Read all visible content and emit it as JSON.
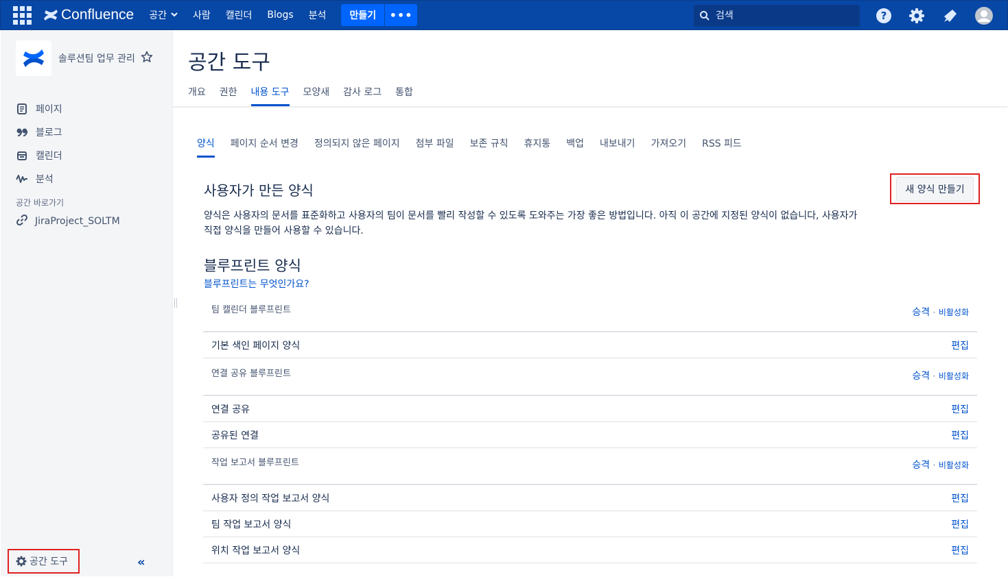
{
  "topnav": {
    "logo_text": "Confluence",
    "items": [
      "공간",
      "사람",
      "캘린더",
      "Blogs",
      "분석"
    ],
    "create_label": "만들기",
    "more_label": "•••",
    "search_placeholder": "검색"
  },
  "sidebar": {
    "space_name": "솔루션팀 업무 관리",
    "nav": [
      {
        "label": "페이지",
        "icon": "page-icon"
      },
      {
        "label": "블로그",
        "icon": "quote-icon"
      },
      {
        "label": "캘린더",
        "icon": "calendar-icon"
      },
      {
        "label": "분석",
        "icon": "analytics-icon"
      }
    ],
    "shortcuts_title": "공간 바로가기",
    "shortcut": "JiraProject_SOLTM",
    "space_tools": "공간 도구",
    "collapse": "«"
  },
  "main": {
    "title": "공간 도구",
    "tabs": [
      "개요",
      "권한",
      "내용 도구",
      "모양새",
      "감사 로그",
      "통합"
    ],
    "active_tab": 2,
    "subtabs": [
      "양식",
      "페이지 순서 변경",
      "정의되지 않은 페이지",
      "첨부 파일",
      "보존 규칙",
      "휴지통",
      "백업",
      "내보내기",
      "가져오기",
      "RSS 피드"
    ],
    "active_subtab": 0,
    "user_templates_title": "사용자가 만든 양식",
    "new_template_button": "새 양식 만들기",
    "description_line1": "양식은 사용자의 문서를 표준화하고 사용자의 팀이 문서를 빨리 작성할 수 있도록 도와주는 가장 좋은 방법입니다. 아직 이 공간에 지정된 양식이 없습니다, 사용자가",
    "description_line2": "직접 양식을 만들어 사용할 수 있습니다.",
    "blueprint_title": "블루프린트 양식",
    "what_link": "블루프린트는 무엇인가요?",
    "promote": "승격",
    "sep": "·",
    "disable": "비활성화",
    "edit": "편집",
    "groups": [
      {
        "name": "팀 캘린더 블루프린트",
        "rows": [
          "기본 색인 페이지 양식"
        ]
      },
      {
        "name": "연결 공유 블루프린트",
        "rows": [
          "연결 공유",
          "공유된 연결"
        ]
      },
      {
        "name": "작업 보고서 블루프린트",
        "rows": [
          "사용자 정의 작업 보고서 양식",
          "팀 작업 보고서 양식",
          "위치 작업 보고서 양식"
        ]
      }
    ]
  }
}
